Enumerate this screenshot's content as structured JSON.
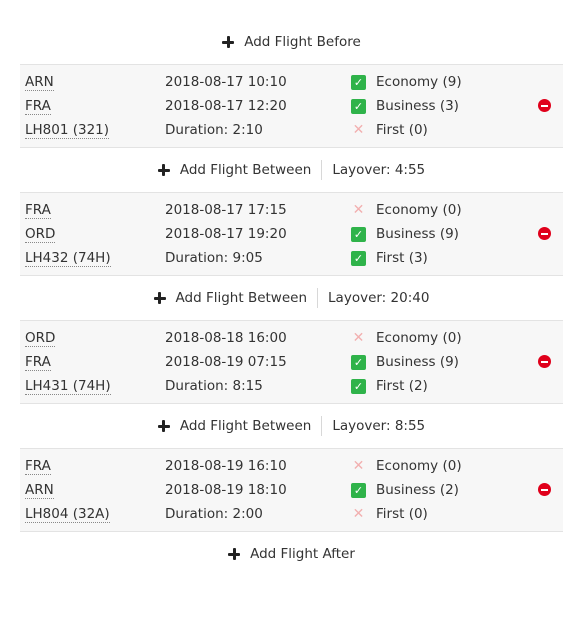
{
  "actions": {
    "add_before": "Add Flight Before",
    "add_between": "Add Flight Between",
    "add_after": "Add Flight After"
  },
  "flights": [
    {
      "origin": "ARN",
      "destination": "FRA",
      "flight": "LH801 (321)",
      "departure": "2018-08-17 10:10",
      "arrival": "2018-08-17 12:20",
      "duration": "Duration: 2:10",
      "classes": [
        {
          "label": "Economy (9)",
          "available": true
        },
        {
          "label": "Business (3)",
          "available": true
        },
        {
          "label": "First (0)",
          "available": false
        }
      ]
    },
    {
      "origin": "FRA",
      "destination": "ORD",
      "flight": "LH432 (74H)",
      "departure": "2018-08-17 17:15",
      "arrival": "2018-08-17 19:20",
      "duration": "Duration: 9:05",
      "classes": [
        {
          "label": "Economy (0)",
          "available": false
        },
        {
          "label": "Business (9)",
          "available": true
        },
        {
          "label": "First (3)",
          "available": true
        }
      ]
    },
    {
      "origin": "ORD",
      "destination": "FRA",
      "flight": "LH431 (74H)",
      "departure": "2018-08-18 16:00",
      "arrival": "2018-08-19 07:15",
      "duration": "Duration: 8:15",
      "classes": [
        {
          "label": "Economy (0)",
          "available": false
        },
        {
          "label": "Business (9)",
          "available": true
        },
        {
          "label": "First (2)",
          "available": true
        }
      ]
    },
    {
      "origin": "FRA",
      "destination": "ARN",
      "flight": "LH804 (32A)",
      "departure": "2018-08-19 16:10",
      "arrival": "2018-08-19 18:10",
      "duration": "Duration: 2:00",
      "classes": [
        {
          "label": "Economy (0)",
          "available": false
        },
        {
          "label": "Business (2)",
          "available": true
        },
        {
          "label": "First (0)",
          "available": false
        }
      ]
    }
  ],
  "layovers": [
    "Layover: 4:55",
    "Layover: 20:40",
    "Layover: 8:55"
  ],
  "colors": {
    "available": "#2fb34a",
    "unavailable": "#f2b0b0",
    "remove": "#e0001b"
  },
  "icons": {
    "add": "plus-icon",
    "available": "check-icon",
    "unavailable": "x-icon",
    "remove": "remove-icon"
  }
}
